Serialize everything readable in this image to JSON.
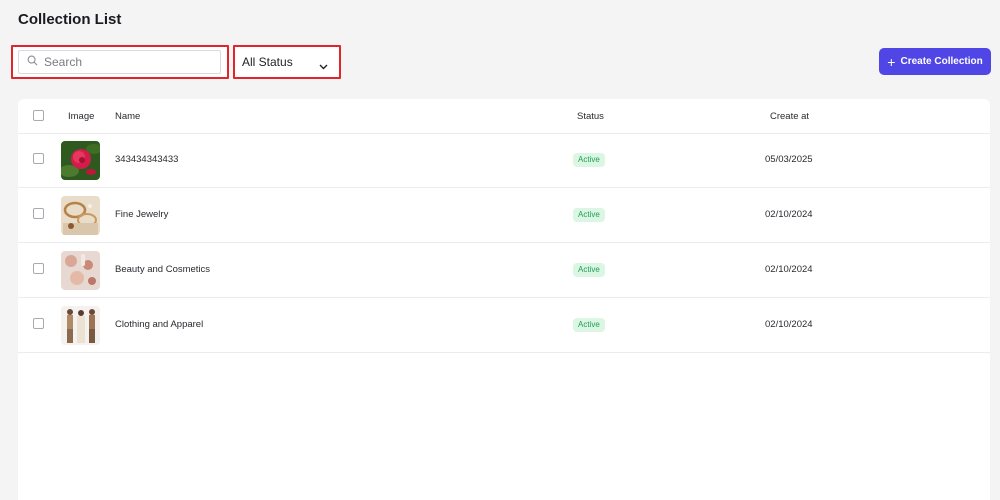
{
  "page": {
    "title": "Collection List"
  },
  "toolbar": {
    "search_placeholder": "Search",
    "status_filter": "All Status",
    "create_label": "Create Collection",
    "create_icon": "plus-icon",
    "accent_color": "#4f46e5"
  },
  "table": {
    "headers": {
      "image": "Image",
      "name": "Name",
      "status": "Status",
      "created": "Create at"
    },
    "rows": [
      {
        "name": "343434343433",
        "status": "Active",
        "created": "05/03/2025",
        "image": "rose-flower"
      },
      {
        "name": "Fine Jewelry",
        "status": "Active",
        "created": "02/10/2024",
        "image": "jewelry"
      },
      {
        "name": "Beauty and Cosmetics",
        "status": "Active",
        "created": "02/10/2024",
        "image": "cosmetics"
      },
      {
        "name": "Clothing and Apparel",
        "status": "Active",
        "created": "02/10/2024",
        "image": "apparel-models"
      }
    ],
    "status_color": "#1f9d55"
  }
}
